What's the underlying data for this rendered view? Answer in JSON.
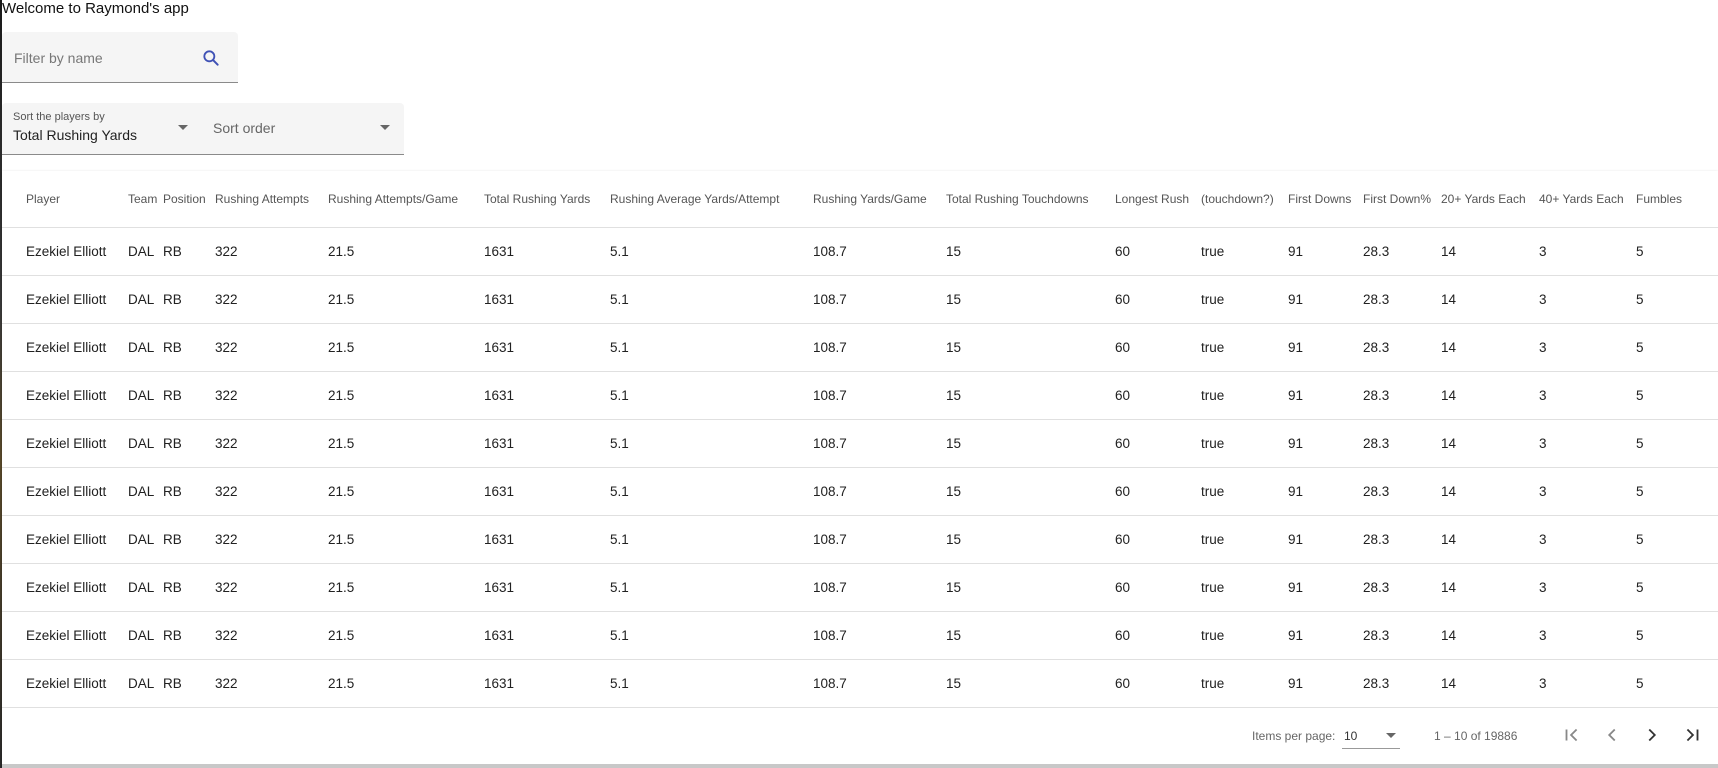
{
  "app": {
    "welcome": "Welcome to Raymond's app"
  },
  "search": {
    "placeholder": "Filter by name",
    "icon": "search-icon",
    "accent": "#3f51b5"
  },
  "sort": {
    "by_label": "Sort the players by",
    "by_value": "Total Rushing Yards",
    "order_placeholder": "Sort order"
  },
  "table": {
    "headers": [
      "Player",
      "Team",
      "Position",
      "Rushing Attempts",
      "Rushing Attempts/Game",
      "Total Rushing Yards",
      "Rushing Average Yards/Attempt",
      "Rushing Yards/Game",
      "Total Rushing Touchdowns",
      "Longest Rush",
      "(touchdown?)",
      "First Downs",
      "First Down%",
      "20+ Yards Each",
      "40+ Yards Each",
      "Fumbles"
    ],
    "rows": [
      [
        "Ezekiel Elliott",
        "DAL",
        "RB",
        "322",
        "21.5",
        "1631",
        "5.1",
        "108.7",
        "15",
        "60",
        "true",
        "91",
        "28.3",
        "14",
        "3",
        "5"
      ],
      [
        "Ezekiel Elliott",
        "DAL",
        "RB",
        "322",
        "21.5",
        "1631",
        "5.1",
        "108.7",
        "15",
        "60",
        "true",
        "91",
        "28.3",
        "14",
        "3",
        "5"
      ],
      [
        "Ezekiel Elliott",
        "DAL",
        "RB",
        "322",
        "21.5",
        "1631",
        "5.1",
        "108.7",
        "15",
        "60",
        "true",
        "91",
        "28.3",
        "14",
        "3",
        "5"
      ],
      [
        "Ezekiel Elliott",
        "DAL",
        "RB",
        "322",
        "21.5",
        "1631",
        "5.1",
        "108.7",
        "15",
        "60",
        "true",
        "91",
        "28.3",
        "14",
        "3",
        "5"
      ],
      [
        "Ezekiel Elliott",
        "DAL",
        "RB",
        "322",
        "21.5",
        "1631",
        "5.1",
        "108.7",
        "15",
        "60",
        "true",
        "91",
        "28.3",
        "14",
        "3",
        "5"
      ],
      [
        "Ezekiel Elliott",
        "DAL",
        "RB",
        "322",
        "21.5",
        "1631",
        "5.1",
        "108.7",
        "15",
        "60",
        "true",
        "91",
        "28.3",
        "14",
        "3",
        "5"
      ],
      [
        "Ezekiel Elliott",
        "DAL",
        "RB",
        "322",
        "21.5",
        "1631",
        "5.1",
        "108.7",
        "15",
        "60",
        "true",
        "91",
        "28.3",
        "14",
        "3",
        "5"
      ],
      [
        "Ezekiel Elliott",
        "DAL",
        "RB",
        "322",
        "21.5",
        "1631",
        "5.1",
        "108.7",
        "15",
        "60",
        "true",
        "91",
        "28.3",
        "14",
        "3",
        "5"
      ],
      [
        "Ezekiel Elliott",
        "DAL",
        "RB",
        "322",
        "21.5",
        "1631",
        "5.1",
        "108.7",
        "15",
        "60",
        "true",
        "91",
        "28.3",
        "14",
        "3",
        "5"
      ],
      [
        "Ezekiel Elliott",
        "DAL",
        "RB",
        "322",
        "21.5",
        "1631",
        "5.1",
        "108.7",
        "15",
        "60",
        "true",
        "91",
        "28.3",
        "14",
        "3",
        "5"
      ]
    ]
  },
  "paginator": {
    "items_per_page_label": "Items per page:",
    "items_per_page": "10",
    "range": "1 – 10 of 19886",
    "buttons": [
      "first-page-icon",
      "previous-page-icon",
      "next-page-icon",
      "last-page-icon"
    ]
  }
}
